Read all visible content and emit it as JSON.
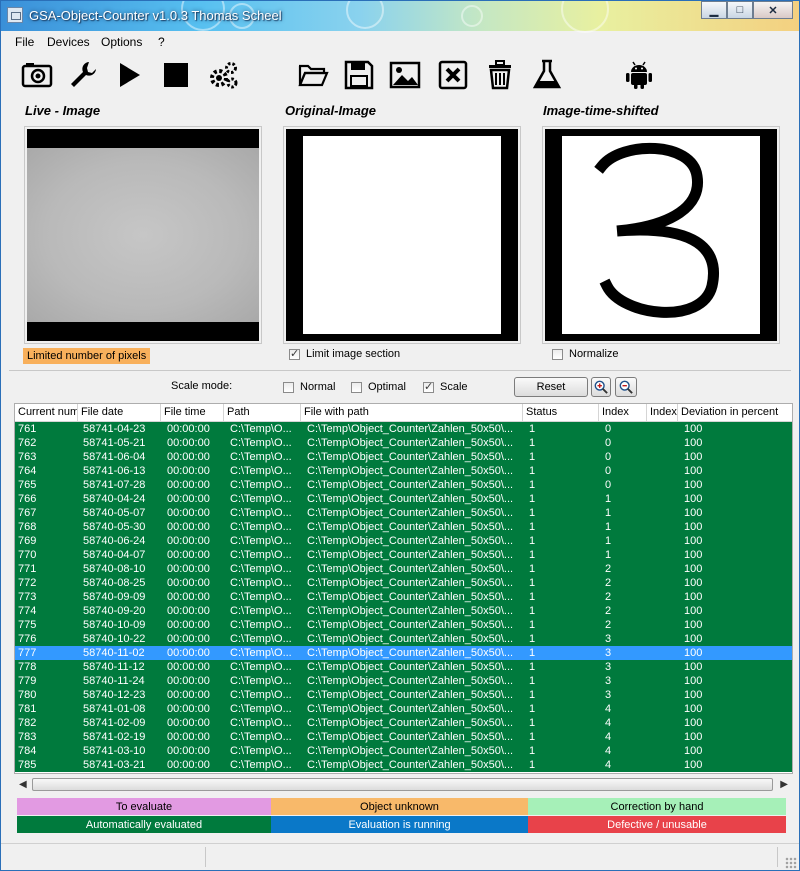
{
  "window": {
    "title": "GSA-Object-Counter v1.0.3  Thomas Scheel"
  },
  "window_buttons": {
    "minimize": "▁",
    "maximize": "□",
    "close": "✕"
  },
  "menu": [
    "File",
    "Devices",
    "Options",
    "?"
  ],
  "toolbar": {
    "icons": [
      "camera-icon",
      "wrench-icon",
      "play-icon",
      "stop-icon",
      "gears-icon",
      "open-folder-icon",
      "save-icon",
      "image-icon",
      "delete-box-icon",
      "trash-icon",
      "flask-icon",
      "android-icon"
    ]
  },
  "panels": {
    "live": {
      "title": "Live - Image",
      "badge": "Limited number of pixels"
    },
    "original": {
      "title": "Original-Image",
      "checkbox_label": "Limit image section",
      "checked": true
    },
    "shifted": {
      "title": "Image-time-shifted",
      "checkbox_label": "Normalize",
      "checked": false,
      "digit": "3"
    }
  },
  "scale": {
    "label": "Scale mode:",
    "options": [
      {
        "label": "Normal",
        "checked": false
      },
      {
        "label": "Optimal",
        "checked": false
      },
      {
        "label": "Scale",
        "checked": true
      }
    ],
    "reset_label": "Reset"
  },
  "table": {
    "columns": [
      "Current numb",
      "File date",
      "File time",
      "Path",
      "File with path",
      "Status",
      "Index",
      "Index",
      "Deviation in percent"
    ],
    "selected_row": "777",
    "rows": [
      [
        "761",
        "58741-04-23",
        "00:00:00",
        "C:\\Temp\\O...",
        "C:\\Temp\\Object_Counter\\Zahlen_50x50\\...",
        "1",
        "0",
        "",
        "100"
      ],
      [
        "762",
        "58741-05-21",
        "00:00:00",
        "C:\\Temp\\O...",
        "C:\\Temp\\Object_Counter\\Zahlen_50x50\\...",
        "1",
        "0",
        "",
        "100"
      ],
      [
        "763",
        "58741-06-04",
        "00:00:00",
        "C:\\Temp\\O...",
        "C:\\Temp\\Object_Counter\\Zahlen_50x50\\...",
        "1",
        "0",
        "",
        "100"
      ],
      [
        "764",
        "58741-06-13",
        "00:00:00",
        "C:\\Temp\\O...",
        "C:\\Temp\\Object_Counter\\Zahlen_50x50\\...",
        "1",
        "0",
        "",
        "100"
      ],
      [
        "765",
        "58741-07-28",
        "00:00:00",
        "C:\\Temp\\O...",
        "C:\\Temp\\Object_Counter\\Zahlen_50x50\\...",
        "1",
        "0",
        "",
        "100"
      ],
      [
        "766",
        "58740-04-24",
        "00:00:00",
        "C:\\Temp\\O...",
        "C:\\Temp\\Object_Counter\\Zahlen_50x50\\...",
        "1",
        "1",
        "",
        "100"
      ],
      [
        "767",
        "58740-05-07",
        "00:00:00",
        "C:\\Temp\\O...",
        "C:\\Temp\\Object_Counter\\Zahlen_50x50\\...",
        "1",
        "1",
        "",
        "100"
      ],
      [
        "768",
        "58740-05-30",
        "00:00:00",
        "C:\\Temp\\O...",
        "C:\\Temp\\Object_Counter\\Zahlen_50x50\\...",
        "1",
        "1",
        "",
        "100"
      ],
      [
        "769",
        "58740-06-24",
        "00:00:00",
        "C:\\Temp\\O...",
        "C:\\Temp\\Object_Counter\\Zahlen_50x50\\...",
        "1",
        "1",
        "",
        "100"
      ],
      [
        "770",
        "58740-04-07",
        "00:00:00",
        "C:\\Temp\\O...",
        "C:\\Temp\\Object_Counter\\Zahlen_50x50\\...",
        "1",
        "1",
        "",
        "100"
      ],
      [
        "771",
        "58740-08-10",
        "00:00:00",
        "C:\\Temp\\O...",
        "C:\\Temp\\Object_Counter\\Zahlen_50x50\\...",
        "1",
        "2",
        "",
        "100"
      ],
      [
        "772",
        "58740-08-25",
        "00:00:00",
        "C:\\Temp\\O...",
        "C:\\Temp\\Object_Counter\\Zahlen_50x50\\...",
        "1",
        "2",
        "",
        "100"
      ],
      [
        "773",
        "58740-09-09",
        "00:00:00",
        "C:\\Temp\\O...",
        "C:\\Temp\\Object_Counter\\Zahlen_50x50\\...",
        "1",
        "2",
        "",
        "100"
      ],
      [
        "774",
        "58740-09-20",
        "00:00:00",
        "C:\\Temp\\O...",
        "C:\\Temp\\Object_Counter\\Zahlen_50x50\\...",
        "1",
        "2",
        "",
        "100"
      ],
      [
        "775",
        "58740-10-09",
        "00:00:00",
        "C:\\Temp\\O...",
        "C:\\Temp\\Object_Counter\\Zahlen_50x50\\...",
        "1",
        "2",
        "",
        "100"
      ],
      [
        "776",
        "58740-10-22",
        "00:00:00",
        "C:\\Temp\\O...",
        "C:\\Temp\\Object_Counter\\Zahlen_50x50\\...",
        "1",
        "3",
        "",
        "100"
      ],
      [
        "777",
        "58740-11-02",
        "00:00:00",
        "C:\\Temp\\O...",
        "C:\\Temp\\Object_Counter\\Zahlen_50x50\\...",
        "1",
        "3",
        "",
        "100"
      ],
      [
        "778",
        "58740-11-12",
        "00:00:00",
        "C:\\Temp\\O...",
        "C:\\Temp\\Object_Counter\\Zahlen_50x50\\...",
        "1",
        "3",
        "",
        "100"
      ],
      [
        "779",
        "58740-11-24",
        "00:00:00",
        "C:\\Temp\\O...",
        "C:\\Temp\\Object_Counter\\Zahlen_50x50\\...",
        "1",
        "3",
        "",
        "100"
      ],
      [
        "780",
        "58740-12-23",
        "00:00:00",
        "C:\\Temp\\O...",
        "C:\\Temp\\Object_Counter\\Zahlen_50x50\\...",
        "1",
        "3",
        "",
        "100"
      ],
      [
        "781",
        "58741-01-08",
        "00:00:00",
        "C:\\Temp\\O...",
        "C:\\Temp\\Object_Counter\\Zahlen_50x50\\...",
        "1",
        "4",
        "",
        "100"
      ],
      [
        "782",
        "58741-02-09",
        "00:00:00",
        "C:\\Temp\\O...",
        "C:\\Temp\\Object_Counter\\Zahlen_50x50\\...",
        "1",
        "4",
        "",
        "100"
      ],
      [
        "783",
        "58741-02-19",
        "00:00:00",
        "C:\\Temp\\O...",
        "C:\\Temp\\Object_Counter\\Zahlen_50x50\\...",
        "1",
        "4",
        "",
        "100"
      ],
      [
        "784",
        "58741-03-10",
        "00:00:00",
        "C:\\Temp\\O...",
        "C:\\Temp\\Object_Counter\\Zahlen_50x50\\...",
        "1",
        "4",
        "",
        "100"
      ],
      [
        "785",
        "58741-03-21",
        "00:00:00",
        "C:\\Temp\\O...",
        "C:\\Temp\\Object_Counter\\Zahlen_50x50\\...",
        "1",
        "4",
        "",
        "100"
      ]
    ]
  },
  "legend": [
    {
      "label": "To evaluate",
      "color": "#e29ae2",
      "text_color": "#000000"
    },
    {
      "label": "Object unknown",
      "color": "#f8b96a",
      "text_color": "#000000"
    },
    {
      "label": "Correction by hand",
      "color": "#a6f0b8",
      "text_color": "#000000"
    },
    {
      "label": "Automatically evaluated",
      "color": "#007a3d",
      "text_color": "#ffffff"
    },
    {
      "label": "Evaluation is running",
      "color": "#0a78c8",
      "text_color": "#ffffff"
    },
    {
      "label": "Defective / unusable",
      "color": "#e8424a",
      "text_color": "#ffffff"
    }
  ],
  "colors": {
    "row_evaluated": "#007a3d",
    "row_selected": "#3399ff"
  }
}
